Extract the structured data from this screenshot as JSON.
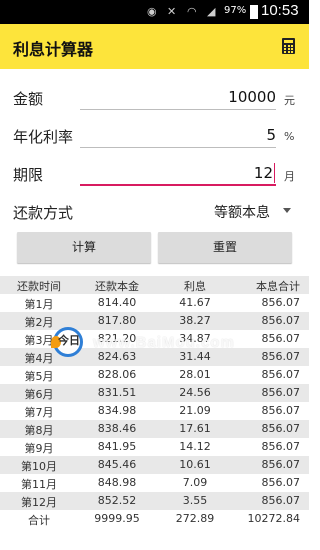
{
  "status_bar": {
    "icons": [
      "eye-icon",
      "mute-icon",
      "wifi-icon",
      "signal-icon"
    ],
    "battery": "97%",
    "time": "10:53"
  },
  "app_bar": {
    "title": "利息计算器",
    "icon": "calculator-icon",
    "color": "#fde43b"
  },
  "form": {
    "amount": {
      "label": "金额",
      "value": "10000",
      "unit": "元"
    },
    "rate": {
      "label": "年化利率",
      "value": "5",
      "unit": "%"
    },
    "term": {
      "label": "期限",
      "value": "12",
      "unit": "月"
    },
    "method": {
      "label": "还款方式",
      "value": "等额本息"
    }
  },
  "buttons": {
    "calculate": "计算",
    "reset": "重置"
  },
  "table": {
    "headers": [
      "还款时间",
      "还款本金",
      "利息",
      "本息合计"
    ],
    "rows": [
      [
        "第1月",
        "814.40",
        "41.67",
        "856.07"
      ],
      [
        "第2月",
        "817.80",
        "38.27",
        "856.07"
      ],
      [
        "第3月",
        "821.20",
        "34.87",
        "856.07"
      ],
      [
        "第4月",
        "824.63",
        "31.44",
        "856.07"
      ],
      [
        "第5月",
        "828.06",
        "28.01",
        "856.07"
      ],
      [
        "第6月",
        "831.51",
        "24.56",
        "856.07"
      ],
      [
        "第7月",
        "834.98",
        "21.09",
        "856.07"
      ],
      [
        "第8月",
        "838.46",
        "17.61",
        "856.07"
      ],
      [
        "第9月",
        "841.95",
        "14.12",
        "856.07"
      ],
      [
        "第10月",
        "845.46",
        "10.61",
        "856.07"
      ],
      [
        "第11月",
        "848.98",
        "7.09",
        "856.07"
      ],
      [
        "第12月",
        "852.52",
        "3.55",
        "856.07"
      ]
    ],
    "total": [
      "合计",
      "9999.95",
      "272.89",
      "10272.84"
    ]
  },
  "watermark": {
    "logo_text": "今日",
    "site": "www.BaiMou.com"
  }
}
